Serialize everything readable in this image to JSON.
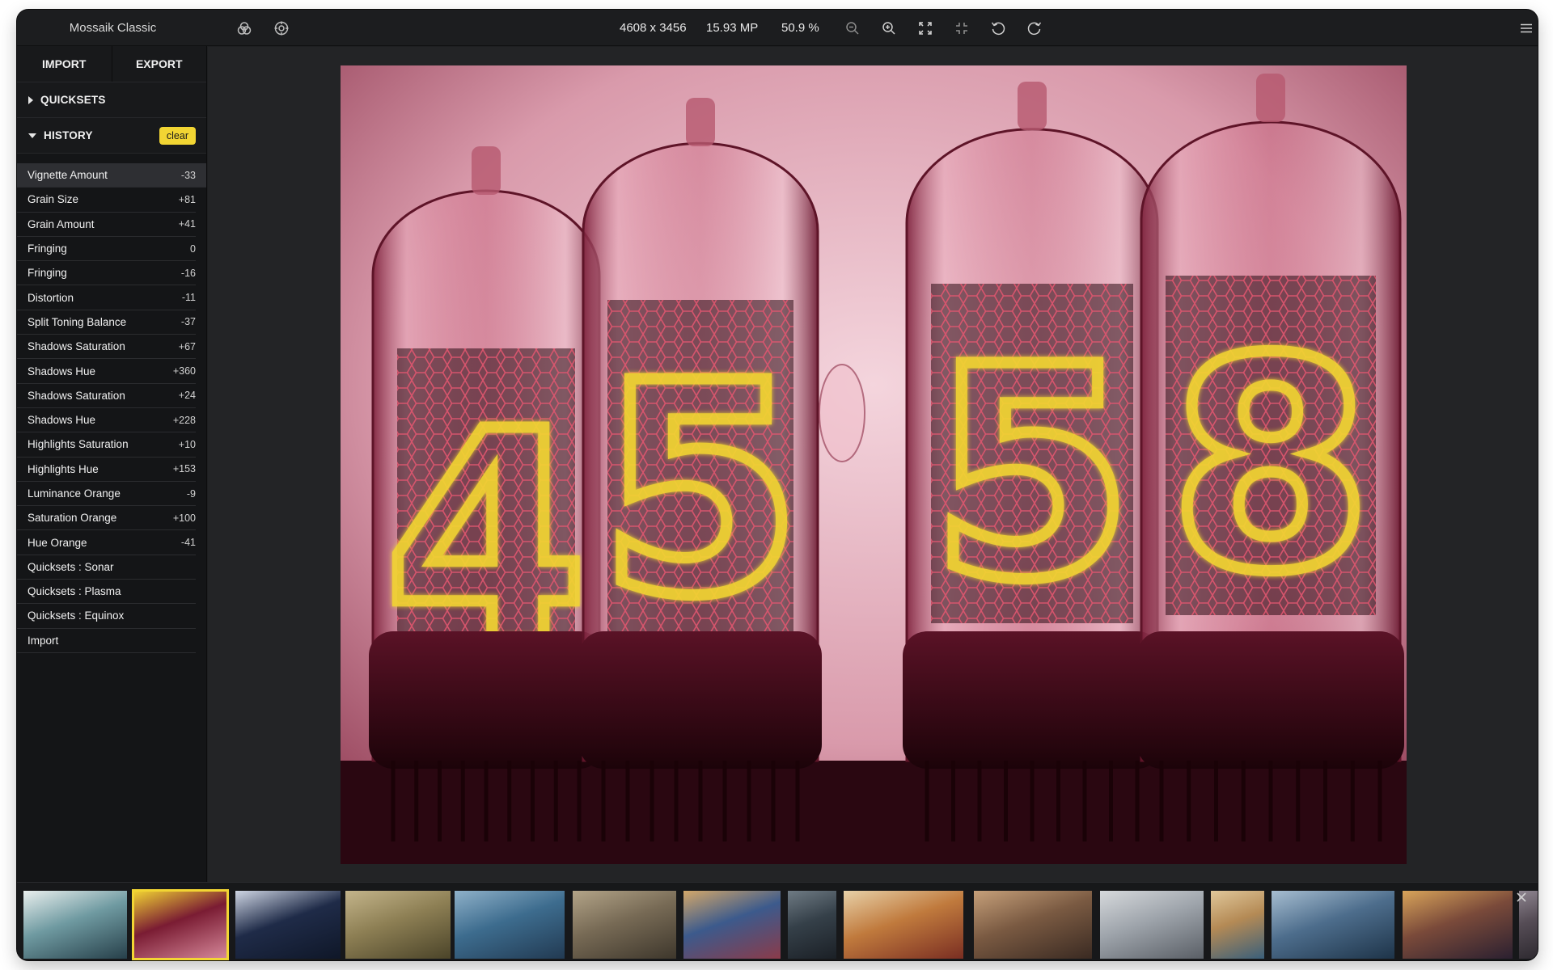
{
  "app": {
    "title": "Mossaik Classic"
  },
  "toolbar": {
    "dimensions": "4608 x 3456",
    "megapixels": "15.93 MP",
    "zoom": "50.9 %",
    "icons": [
      "color-circles-icon",
      "target-icon",
      "zoom-out-icon",
      "zoom-in-icon",
      "fit-screen-icon",
      "collapse-icon",
      "rotate-left-icon",
      "rotate-right-icon",
      "menu-icon"
    ]
  },
  "sidebar": {
    "tabs": [
      {
        "label": "IMPORT"
      },
      {
        "label": "EXPORT"
      }
    ],
    "quicksets": {
      "label": "QUICKSETS",
      "expanded": false
    },
    "history": {
      "label": "HISTORY",
      "expanded": true,
      "clear_label": "clear",
      "items": [
        {
          "name": "Vignette Amount",
          "value": "-33"
        },
        {
          "name": "Grain Size",
          "value": "+81"
        },
        {
          "name": "Grain Amount",
          "value": "+41"
        },
        {
          "name": "Fringing",
          "value": "0"
        },
        {
          "name": "Fringing",
          "value": "-16"
        },
        {
          "name": "Distortion",
          "value": "-11"
        },
        {
          "name": "Split Toning Balance",
          "value": "-37"
        },
        {
          "name": "Shadows Saturation",
          "value": "+67"
        },
        {
          "name": "Shadows Hue",
          "value": "+360"
        },
        {
          "name": "Shadows Saturation",
          "value": "+24"
        },
        {
          "name": "Shadows Hue",
          "value": "+228"
        },
        {
          "name": "Highlights Saturation",
          "value": "+10"
        },
        {
          "name": "Highlights Hue",
          "value": "+153"
        },
        {
          "name": "Luminance Orange",
          "value": "-9"
        },
        {
          "name": "Saturation Orange",
          "value": "+100"
        },
        {
          "name": "Hue Orange",
          "value": "-41"
        },
        {
          "name": "Quicksets : Sonar",
          "value": ""
        },
        {
          "name": "Quicksets : Plasma",
          "value": ""
        },
        {
          "name": "Quicksets : Equinox",
          "value": ""
        },
        {
          "name": "Import",
          "value": ""
        }
      ]
    }
  },
  "photo": {
    "subject": "nixie tubes showing 4 5 5 8",
    "digits": [
      "4",
      "5",
      "5",
      "8"
    ],
    "tint": "#c8385e",
    "glow": "#f2d533"
  },
  "filmstrip": {
    "selected_index": 1,
    "thumbs": [
      {
        "name": "ocean-wave-thumb",
        "colors": [
          "#27404a",
          "#6f9aa1",
          "#e9efee"
        ]
      },
      {
        "name": "nixie-tubes-thumb",
        "colors": [
          "#d6889a",
          "#7a1c33",
          "#f2d533"
        ]
      },
      {
        "name": "night-tents-thumb",
        "colors": [
          "#0f1728",
          "#1f2b48",
          "#cfd6e4"
        ]
      },
      {
        "name": "wheat-field-thumb",
        "colors": [
          "#4b4429",
          "#8d7f54",
          "#c4b58b"
        ]
      },
      {
        "name": "blue-house-thumb",
        "colors": [
          "#223a52",
          "#3d6c8e",
          "#8fb1c9"
        ]
      },
      {
        "name": "empty-room-thumb",
        "colors": [
          "#3e372c",
          "#776a55",
          "#b3a488"
        ]
      },
      {
        "name": "street-art-thumb",
        "colors": [
          "#8a3b4a",
          "#3c5a8c",
          "#d4a86a"
        ]
      },
      {
        "name": "dark-alley-thumb",
        "colors": [
          "#1b2026",
          "#354049",
          "#6f7b84"
        ]
      },
      {
        "name": "matryoshka-thumb",
        "colors": [
          "#7a2e22",
          "#c07a3d",
          "#e8d1a8"
        ]
      },
      {
        "name": "market-thumb",
        "colors": [
          "#3a2a22",
          "#7a5a42",
          "#c6a07a"
        ]
      },
      {
        "name": "bare-tree-thumb",
        "colors": [
          "#5a5f66",
          "#9ea4ab",
          "#d6d9dc"
        ]
      },
      {
        "name": "camel-thumb",
        "colors": [
          "#3a5f7a",
          "#b48a55",
          "#e0c79a"
        ]
      },
      {
        "name": "lake-balloon-thumb",
        "colors": [
          "#1e3449",
          "#4d6d8c",
          "#a7bed1"
        ]
      },
      {
        "name": "cathedral-thumb",
        "colors": [
          "#2b2030",
          "#7a4a3a",
          "#d9a45a"
        ]
      },
      {
        "name": "partial-thumb",
        "colors": [
          "#2e2a30",
          "#564d56",
          "#8e8590"
        ]
      }
    ]
  }
}
